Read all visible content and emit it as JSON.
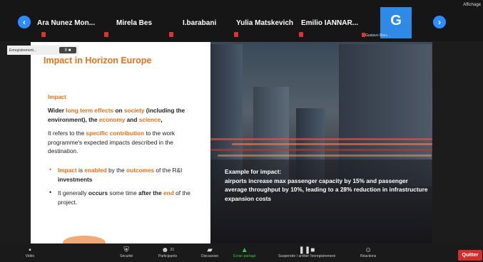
{
  "participants": [
    {
      "name": "Ara Nunez Mon..."
    },
    {
      "name": "Mirela Bes"
    },
    {
      "name": "I.barabani"
    },
    {
      "name": "Yulia Matskevich"
    },
    {
      "name": "Emilio IANNAR..."
    }
  ],
  "avatar": {
    "initial": "G",
    "name": "Gustavo Marc..."
  },
  "affichage": "Affichage",
  "recording": {
    "label": "Enregistrement...",
    "controls": "II  ■"
  },
  "slide": {
    "title": "Impact  in Horizon Europe",
    "heading": "Impact",
    "para1_a": "Wider ",
    "para1_b": "long term effects",
    "para1_c": " on ",
    "para1_d": "society",
    "para1_e": " (including the environment), the ",
    "para1_f": "economy",
    "para1_g": " and ",
    "para1_h": "science",
    "para1_i": ",",
    "para2_a": "It refers to the ",
    "para2_b": "specific contribution",
    "para2_c": " to the work programme's expected impacts described in the destination.",
    "b1_a": "Impact",
    "b1_b": " is ",
    "b1_c": "enabled",
    "b1_d": " by the ",
    "b1_e": "outcomes",
    "b1_f": " of the R&I ",
    "b1_g": "investments",
    "b2_a": "It generally ",
    "b2_b": "occurs",
    "b2_c": " some time ",
    "b2_d": "after the",
    "b2_e": " ",
    "b2_f": "end",
    "b2_g": " of the project.",
    "example_title": "Example for impact:",
    "example_body": "airports increase max passenger capacity by 15% and passenger average throughput by 10%, leading to a 28% reduction in infrastructure expansion costs"
  },
  "toolbar": {
    "video": "Vidéo",
    "security": "Sécurité",
    "participants": "Participants",
    "participants_count": "21",
    "discussion": "Discussion",
    "share": "Écran partagé",
    "interp": "Suspendre / arrêter l'enregistrement",
    "reactions": "Réactions",
    "quit": "Quitter"
  },
  "colors": {
    "accent": "#2d8cff",
    "slide_orange": "#e8701a",
    "quit": "#d32c2c"
  }
}
